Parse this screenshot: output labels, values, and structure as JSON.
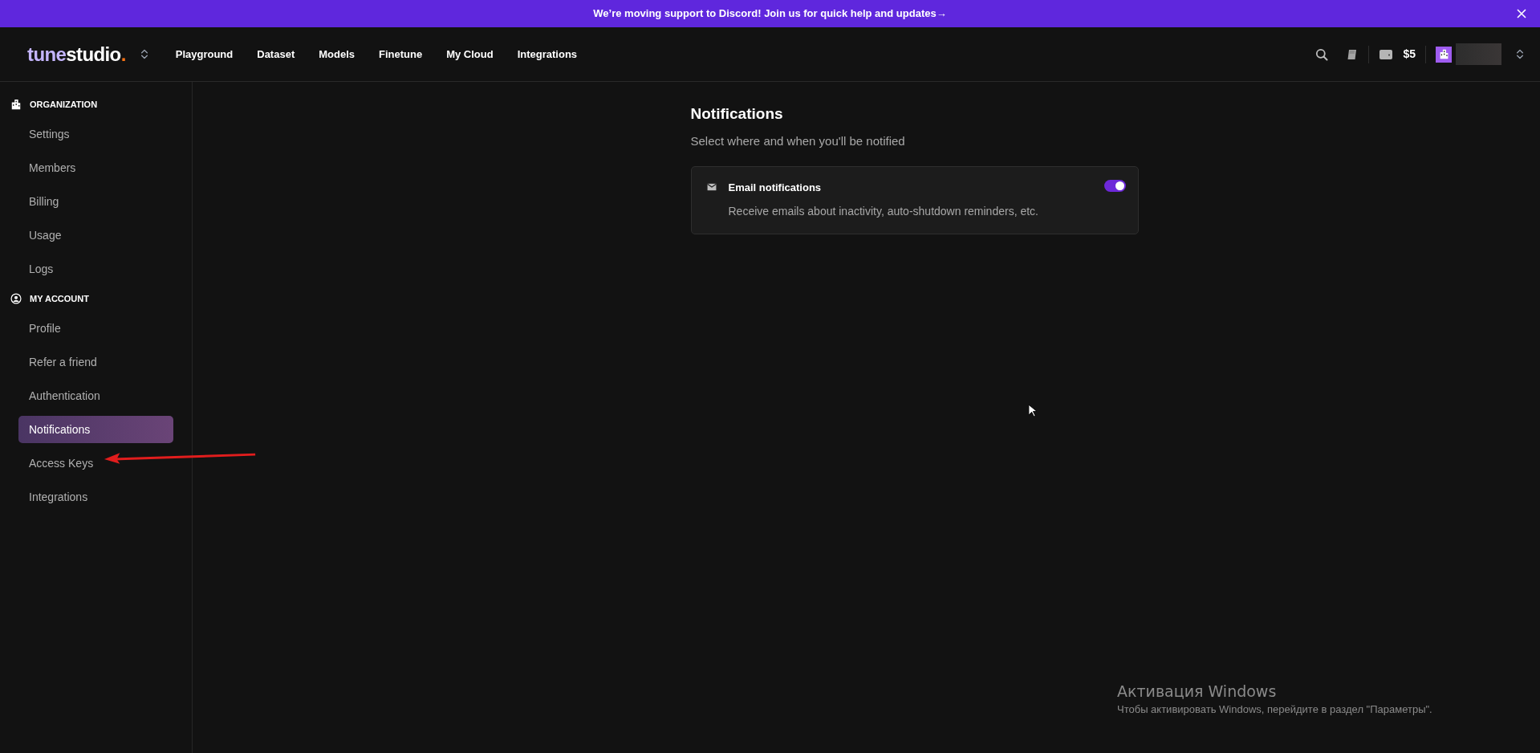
{
  "banner": {
    "text": "We’re moving support to Discord! Join us for quick help and updates",
    "arrow": "→"
  },
  "header": {
    "logo": {
      "first": "tune",
      "second": "studio",
      "dot": "."
    },
    "nav": [
      {
        "label": "Playground",
        "selected": false
      },
      {
        "label": "Dataset",
        "selected": false
      },
      {
        "label": "Models",
        "selected": false
      },
      {
        "label": "Finetune",
        "selected": false
      },
      {
        "label": "My Cloud",
        "selected": false
      },
      {
        "label": "Integrations",
        "selected": false
      }
    ],
    "balance": "$5"
  },
  "sidebar": {
    "sections": [
      {
        "kind": "organization",
        "title": "ORGANIZATION",
        "items": [
          {
            "label": "Settings",
            "selected": false
          },
          {
            "label": "Members",
            "selected": false
          },
          {
            "label": "Billing",
            "selected": false
          },
          {
            "label": "Usage",
            "selected": false
          },
          {
            "label": "Logs",
            "selected": false
          }
        ]
      },
      {
        "kind": "account",
        "title": "MY ACCOUNT",
        "items": [
          {
            "label": "Profile",
            "selected": false
          },
          {
            "label": "Refer a friend",
            "selected": false
          },
          {
            "label": "Authentication",
            "selected": false
          },
          {
            "label": "Notifications",
            "selected": true
          },
          {
            "label": "Access Keys",
            "selected": false
          },
          {
            "label": "Integrations",
            "selected": false
          }
        ]
      }
    ]
  },
  "main": {
    "title": "Notifications",
    "subtitle": "Select where and when you'll be notified",
    "settings": [
      {
        "title": "Email notifications",
        "description": "Receive emails about inactivity, auto-shutdown reminders, etc.",
        "on": true
      }
    ]
  },
  "os_notice": {
    "title": "Активация Windows",
    "text": "Чтобы активировать Windows, перейдите в раздел \"Параметры\"."
  }
}
